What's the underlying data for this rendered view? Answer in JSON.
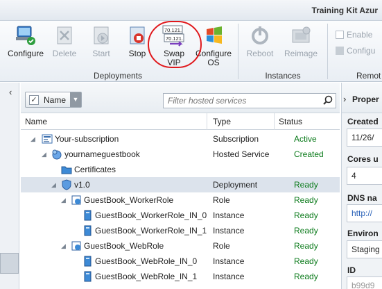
{
  "window": {
    "title": "Training Kit  Azur"
  },
  "ribbon": {
    "buttons": {
      "configure": "Configure",
      "delete": "Delete",
      "start": "Start",
      "stop": "Stop",
      "swap_vip_1": "Swap",
      "swap_vip_2": "VIP",
      "configure_os_1": "Configure",
      "configure_os_2": "OS",
      "reboot": "Reboot",
      "reimage": "Reimage",
      "enable": "Enable",
      "configure_remote": "Configu"
    },
    "groups": {
      "deployments": "Deployments",
      "instances": "Instances",
      "remote": "Remot"
    },
    "swap_icon_text": {
      "line1": "70.121.",
      "line2": "70.121."
    }
  },
  "toolbar": {
    "name_filter_label": "Name",
    "filter_placeholder": "Filter hosted services"
  },
  "table": {
    "headers": {
      "name": "Name",
      "type": "Type",
      "status": "Status"
    },
    "rows": [
      {
        "name": "Your-subscription",
        "type": "Subscription",
        "status": "Active"
      },
      {
        "name": "yournameguestbook",
        "type": "Hosted Service",
        "status": "Created"
      },
      {
        "name": "Certificates",
        "type": "",
        "status": ""
      },
      {
        "name": "v1.0",
        "type": "Deployment",
        "status": "Ready"
      },
      {
        "name": "GuestBook_WorkerRole",
        "type": "Role",
        "status": "Ready"
      },
      {
        "name": "GuestBook_WorkerRole_IN_0",
        "type": "Instance",
        "status": "Ready"
      },
      {
        "name": "GuestBook_WorkerRole_IN_1",
        "type": "Instance",
        "status": "Ready"
      },
      {
        "name": "GuestBook_WebRole",
        "type": "Role",
        "status": "Ready"
      },
      {
        "name": "GuestBook_WebRole_IN_0",
        "type": "Instance",
        "status": "Ready"
      },
      {
        "name": "GuestBook_WebRole_IN_1",
        "type": "Instance",
        "status": "Ready"
      }
    ]
  },
  "properties": {
    "title": "Proper",
    "fields": [
      {
        "label": "Created",
        "value": "11/26/"
      },
      {
        "label": "Cores u",
        "value": "4"
      },
      {
        "label": "DNS na",
        "value": "http://"
      },
      {
        "label": "Environ",
        "value": "Staging"
      },
      {
        "label": "ID",
        "value": "b99d9"
      }
    ]
  },
  "colors": {
    "ready": "#0a7a1a",
    "highlight": "#e0181c",
    "selected_row": "#dce3ec"
  }
}
